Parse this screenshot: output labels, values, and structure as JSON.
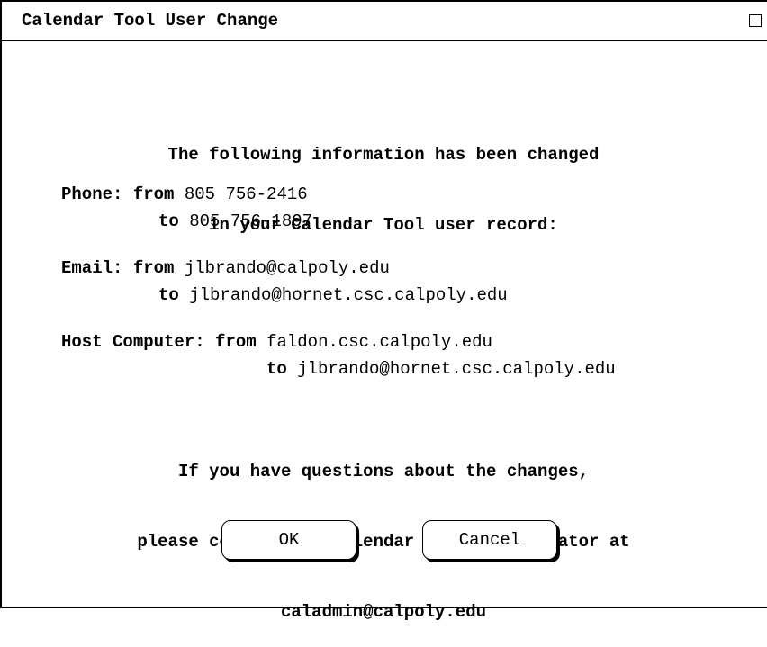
{
  "window": {
    "title": "Calendar Tool User Change"
  },
  "message": {
    "heading_line1": "The following information has been changed",
    "heading_line2": "in your Calendar Tool user record:"
  },
  "changes": {
    "phone": {
      "label": "Phone:",
      "from_word": "from",
      "from_value": "805 756-2416",
      "to_word": "to",
      "to_value": "805 756-1897"
    },
    "email": {
      "label": "Email:",
      "from_word": "from",
      "from_value": "jlbrando@calpoly.edu",
      "to_word": "to",
      "to_value": "jlbrando@hornet.csc.calpoly.edu"
    },
    "host": {
      "label": "Host Computer:",
      "from_word": "from",
      "from_value": "faldon.csc.calpoly.edu",
      "to_word": "to",
      "to_value": "jlbrando@hornet.csc.calpoly.edu"
    }
  },
  "footer": {
    "line1": "If you have questions about the changes,",
    "line2": "please contact the Calendar Tool adminstrator at",
    "line3": "caladmin@calpoly.edu"
  },
  "buttons": {
    "ok_label": "OK",
    "cancel_label": "Cancel"
  }
}
